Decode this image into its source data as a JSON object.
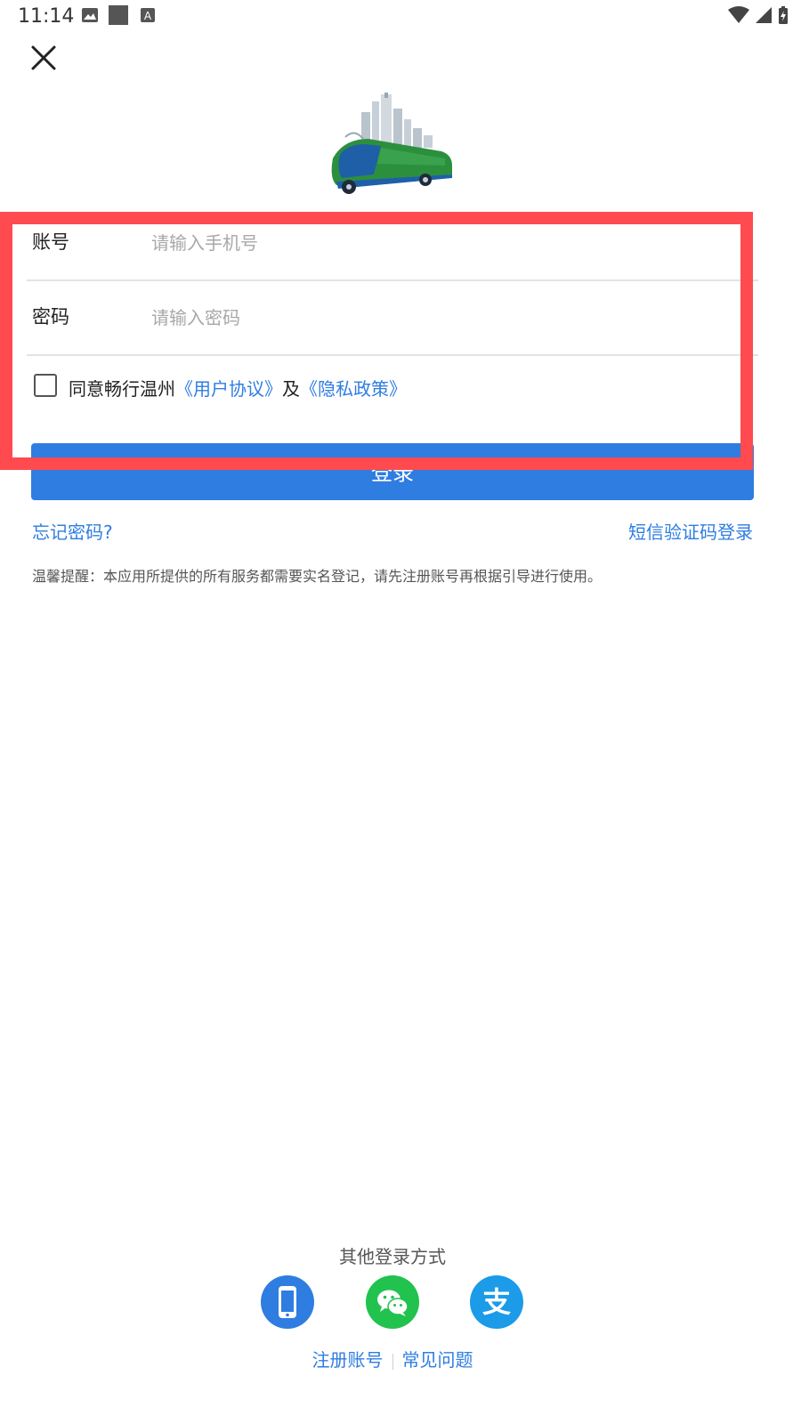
{
  "status_bar": {
    "time": "11:14",
    "icons": [
      "image-icon",
      "square-icon",
      "font-a-icon",
      "wifi-icon",
      "signal-icon",
      "battery-icon"
    ]
  },
  "form": {
    "account_label": "账号",
    "account_placeholder": "请输入手机号",
    "account_value": "",
    "password_label": "密码",
    "password_placeholder": "请输入密码",
    "password_value": "",
    "agree_prefix": "同意畅行温州",
    "user_agreement": "《用户协议》",
    "and_text": "及",
    "privacy_policy": "《隐私政策》",
    "agree_checked": false
  },
  "login_button": "登录",
  "links": {
    "forgot_password": "忘记密码?",
    "sms_login": "短信验证码登录"
  },
  "tip": "温馨提醒：本应用所提供的所有服务都需要实名登记，请先注册账号再根据引导进行使用。",
  "other_login": {
    "title": "其他登录方式",
    "methods": [
      "phone-icon",
      "wechat-icon",
      "alipay-icon"
    ]
  },
  "bottom_links": {
    "register": "注册账号",
    "faq": "常见问题"
  },
  "colors": {
    "primary": "#2f7de1",
    "highlight": "#ff4b4f",
    "wechat": "#21c24e",
    "alipay": "#1b9be8"
  }
}
